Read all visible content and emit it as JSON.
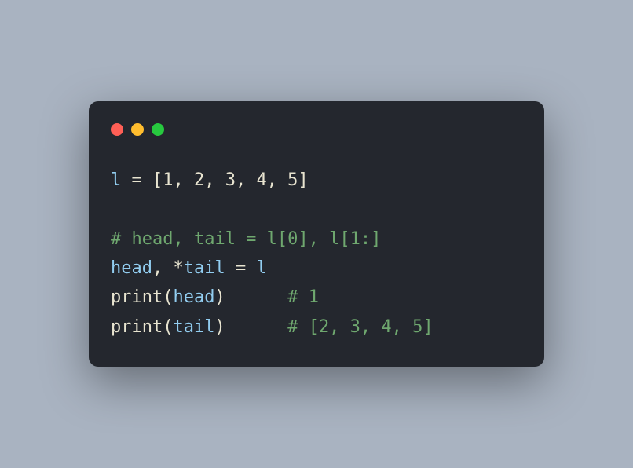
{
  "code": {
    "line1_var": "l",
    "line1_op": " = ",
    "line1_list": "[1, 2, 3, 4, 5]",
    "blank": "",
    "line3_comment": "# head, tail = l[0], l[1:]",
    "line4_head": "head",
    "line4_comma": ", ",
    "line4_star": "*",
    "line4_tail": "tail",
    "line4_op": " = ",
    "line4_l": "l",
    "line5_print": "print",
    "line5_open": "(",
    "line5_arg": "head",
    "line5_close": ")",
    "line5_pad": "      ",
    "line5_comment": "# 1",
    "line6_print": "print",
    "line6_open": "(",
    "line6_arg": "tail",
    "line6_close": ")",
    "line6_pad": "      ",
    "line6_comment": "# [2, 3, 4, 5]"
  }
}
